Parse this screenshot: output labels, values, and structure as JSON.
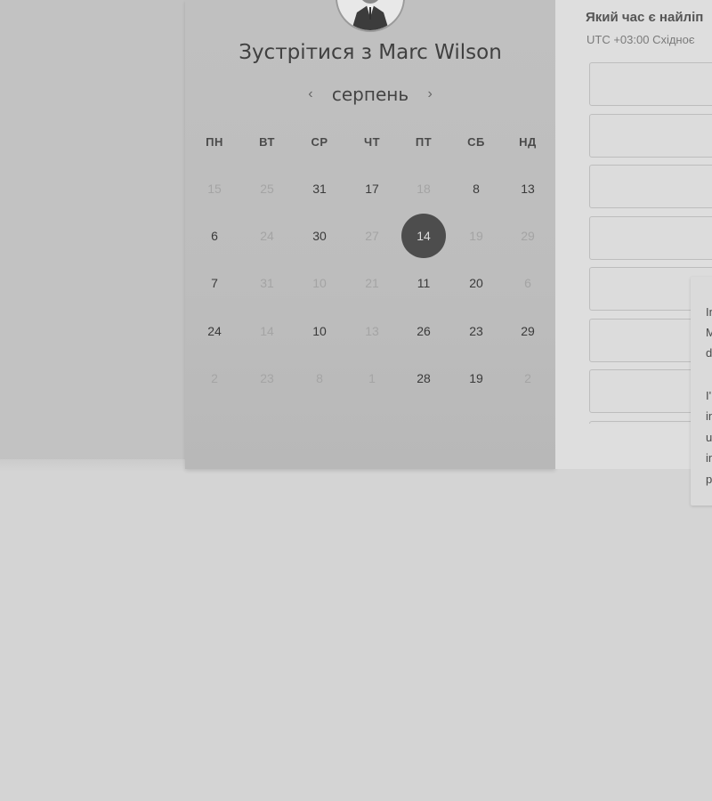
{
  "meeting": {
    "title": "Зустрітися з Marc Wilson"
  },
  "calendar": {
    "month_label": "серпень",
    "prev_arrow": "‹",
    "next_arrow": "›",
    "weekdays": [
      "ПН",
      "ВТ",
      "СР",
      "ЧТ",
      "ПТ",
      "СБ",
      "НД"
    ],
    "weeks": [
      [
        {
          "d": "15",
          "a": false
        },
        {
          "d": "25",
          "a": false
        },
        {
          "d": "31",
          "a": true
        },
        {
          "d": "17",
          "a": true
        },
        {
          "d": "18",
          "a": false
        },
        {
          "d": "8",
          "a": true
        },
        {
          "d": "13",
          "a": true
        }
      ],
      [
        {
          "d": "6",
          "a": true
        },
        {
          "d": "24",
          "a": false
        },
        {
          "d": "30",
          "a": true
        },
        {
          "d": "27",
          "a": false
        },
        {
          "d": "14",
          "a": true,
          "selected": true
        },
        {
          "d": "19",
          "a": false
        },
        {
          "d": "29",
          "a": false
        }
      ],
      [
        {
          "d": "7",
          "a": true
        },
        {
          "d": "31",
          "a": false
        },
        {
          "d": "10",
          "a": false
        },
        {
          "d": "21",
          "a": false
        },
        {
          "d": "11",
          "a": true
        },
        {
          "d": "20",
          "a": true
        },
        {
          "d": "6",
          "a": false
        }
      ],
      [
        {
          "d": "24",
          "a": true
        },
        {
          "d": "14",
          "a": false
        },
        {
          "d": "10",
          "a": true
        },
        {
          "d": "13",
          "a": false
        },
        {
          "d": "26",
          "a": true
        },
        {
          "d": "23",
          "a": true
        },
        {
          "d": "29",
          "a": true
        }
      ],
      [
        {
          "d": "2",
          "a": false
        },
        {
          "d": "23",
          "a": false
        },
        {
          "d": "8",
          "a": false
        },
        {
          "d": "1",
          "a": false
        },
        {
          "d": "28",
          "a": true
        },
        {
          "d": "19",
          "a": true
        },
        {
          "d": "2",
          "a": false
        }
      ]
    ]
  },
  "time_panel": {
    "question": "Який час є найліп",
    "timezone": "UTC +03:00 Східноє",
    "slot_count": 8
  },
  "tooltip": {
    "lines": [
      "In",
      "M",
      "d",
      "",
      "I'",
      "in",
      "u",
      "in",
      "p"
    ]
  },
  "colors": {
    "selected_day_bg": "#4d4d4d",
    "page_bg": "#d4d4d4"
  }
}
